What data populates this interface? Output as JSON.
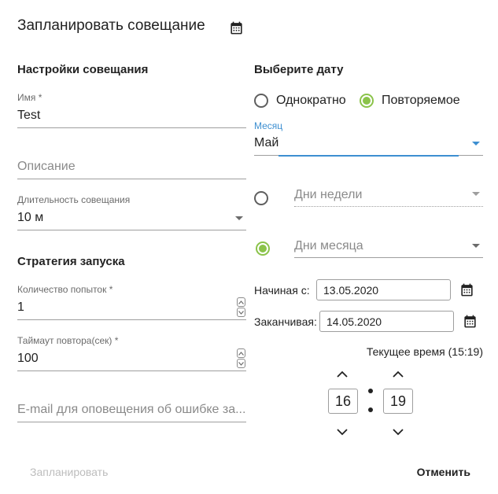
{
  "header": {
    "title": "Запланировать совещание",
    "icon": "calendar-icon"
  },
  "settings": {
    "heading": "Настройки совещания",
    "name": {
      "label": "Имя *",
      "value": "Test"
    },
    "description": {
      "placeholder": "Описание"
    },
    "duration": {
      "label": "Длительность совещания",
      "value": "10 м"
    }
  },
  "strategy": {
    "heading": "Стратегия запуска",
    "attempts": {
      "label": "Количество попыток *",
      "value": "1"
    },
    "timeout": {
      "label": "Таймаут повтора(сек) *",
      "value": "100"
    },
    "email": {
      "placeholder": "E-mail для оповещения об ошибке за..."
    }
  },
  "date": {
    "heading": "Выберите дату",
    "mode": {
      "once_label": "Однократно",
      "repeat_label": "Повторяемое",
      "selected": "repeat"
    },
    "month": {
      "label": "Месяц",
      "value": "Май"
    },
    "weekdays": {
      "placeholder": "Дни недели",
      "selected": false
    },
    "monthdays": {
      "placeholder": "Дни месяца",
      "selected": true
    },
    "start": {
      "label": "Начиная с:",
      "value": "13.05.2020"
    },
    "end": {
      "label": "Заканчивая:",
      "value": "14.05.2020"
    },
    "current_time": "Текущее время (15:19)",
    "time": {
      "hours": "16",
      "minutes": "19"
    }
  },
  "actions": {
    "schedule_label": "Запланировать",
    "cancel_label": "Отменить"
  },
  "colors": {
    "accent": "#3d8fd1",
    "radio_on": "#8bc34a",
    "disabled": "#bdbdbd"
  }
}
